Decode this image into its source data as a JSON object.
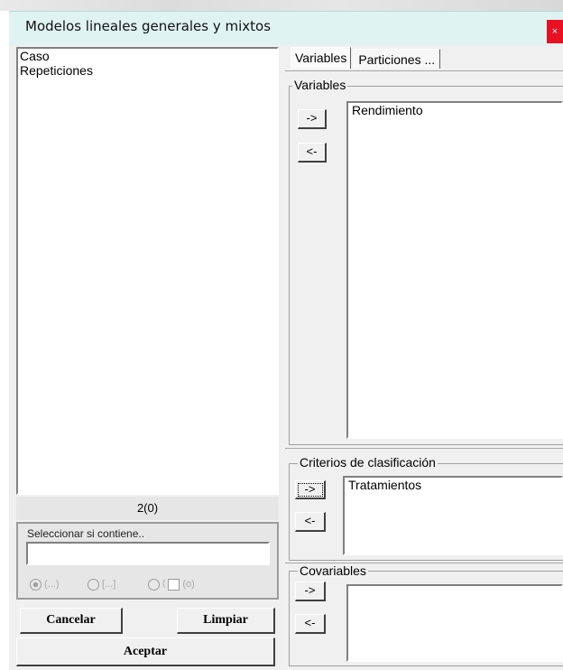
{
  "window": {
    "title": "Modelos lineales generales y mixtos",
    "close_glyph": "×"
  },
  "left_list": {
    "items": [
      "Caso",
      "Repeticiones"
    ],
    "count": "2(0)"
  },
  "filter": {
    "label": "Seleccionar si contiene..",
    "value": "",
    "options": [
      "(...)",
      "[...]",
      "(o)"
    ]
  },
  "buttons": {
    "cancel": "Cancelar",
    "clear": "Limpiar",
    "accept": "Aceptar"
  },
  "tabs": [
    {
      "label": "Variables"
    },
    {
      "label": "Particiones ..."
    }
  ],
  "sections": {
    "variables": {
      "label": "Variables",
      "items": [
        "Rendimiento"
      ],
      "add": "->",
      "remove": "<-"
    },
    "criterios": {
      "label": "Criterios de clasificación",
      "items": [
        "Tratamientos"
      ],
      "add": "->",
      "remove": "<-"
    },
    "covariables": {
      "label": "Covariables",
      "items": [],
      "add": "->",
      "remove": "<-"
    }
  }
}
